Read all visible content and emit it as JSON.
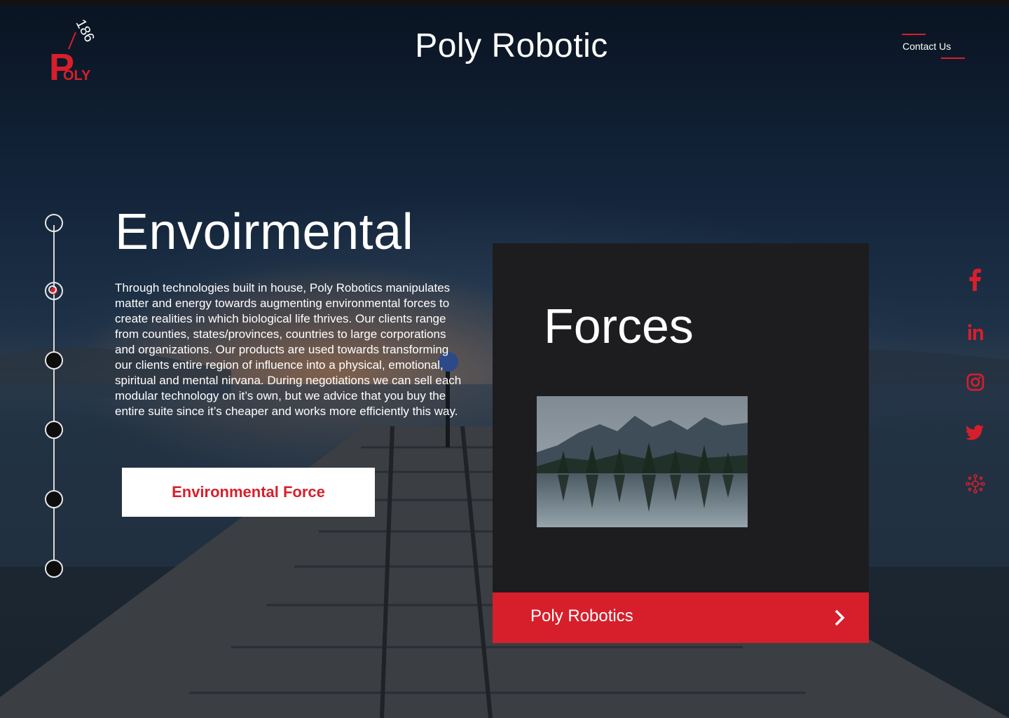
{
  "header": {
    "title": "Poly Robotic",
    "contact_label": "Contact Us",
    "logo": {
      "number": "186",
      "letter": "P",
      "rest": "OLY"
    }
  },
  "stepper": {
    "count": 6,
    "active_index": 1
  },
  "hero": {
    "heading": "Envoirmental",
    "body": "Through technologies built in house, Poly Robotics manipulates matter and energy towards augmenting environmental forces to create realities in which biological life thrives. Our clients range from counties, states/provinces, countries to large corporations and organizations. Our products are used towards transforming our clients entire region of influence into a physical, emotional, spiritual and mental nirvana. During negotiations we can sell each modular technology on it’s own, but we advice that you buy the entire suite since it’s cheaper and works more efficiently this way.",
    "button_label": "Environmental Force"
  },
  "card": {
    "title": "Forces",
    "footer_label": "Poly Robotics",
    "image": "mountain-lake-photo"
  },
  "social": [
    {
      "name": "facebook-icon"
    },
    {
      "name": "linkedin-icon"
    },
    {
      "name": "instagram-icon"
    },
    {
      "name": "twitter-icon"
    },
    {
      "name": "network-icon"
    }
  ],
  "colors": {
    "accent": "#d71f2b",
    "card_bg": "#1d1d1f",
    "text": "#ffffff"
  }
}
